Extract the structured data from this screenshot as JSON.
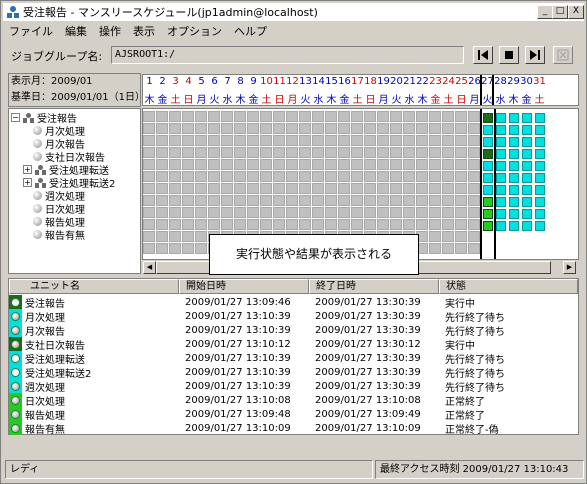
{
  "window": {
    "title": "受注報告 - マンスリースケジュール(jp1admin@localhost)",
    "min": "_",
    "max": "□",
    "close": "X"
  },
  "menu": [
    "ファイル",
    "編集",
    "操作",
    "表示",
    "オプション",
    "ヘルプ"
  ],
  "jobgroup": {
    "label": "ジョブグループ名:",
    "value": "AJSROOT1:/"
  },
  "info": {
    "month": "表示月：2009/01",
    "base": "基準日：2009/01/01（1日）"
  },
  "calendar": {
    "days": [
      "1",
      "2",
      "3",
      "4",
      "5",
      "6",
      "7",
      "8",
      "9",
      "10",
      "11",
      "12",
      "13",
      "14",
      "15",
      "16",
      "17",
      "18",
      "19",
      "20",
      "21",
      "22",
      "23",
      "24",
      "25",
      "26",
      "27",
      "28",
      "29",
      "30",
      "31"
    ],
    "weekdays": [
      "木",
      "金",
      "土",
      "日",
      "月",
      "火",
      "水",
      "木",
      "金",
      "土",
      "日",
      "月",
      "火",
      "水",
      "木",
      "金",
      "土",
      "日",
      "月",
      "火",
      "水",
      "木",
      "金",
      "土",
      "日",
      "月",
      "火",
      "水",
      "木",
      "金",
      "土"
    ],
    "weekday_colors": [
      "#0000c0",
      "#0000c0",
      "#d00000",
      "#d00000",
      "#0000c0",
      "#0000c0",
      "#0000c0",
      "#0000c0",
      "#0000c0",
      "#d00000",
      "#d00000",
      "#d00000",
      "#0000c0",
      "#0000c0",
      "#0000c0",
      "#0000c0",
      "#d00000",
      "#d00000",
      "#0000c0",
      "#0000c0",
      "#0000c0",
      "#0000c0",
      "#d00000",
      "#d00000",
      "#d00000",
      "#0000c0",
      "#0000c0",
      "#0000c0",
      "#0000c0",
      "#0000c0",
      "#d00000"
    ]
  },
  "tree": [
    {
      "label": "受注報告",
      "type": "group",
      "toggle": "⊟"
    },
    {
      "label": "月次処理",
      "type": "job"
    },
    {
      "label": "月次報告",
      "type": "job"
    },
    {
      "label": "支社日次報告",
      "type": "job"
    },
    {
      "label": "受注処理転送",
      "type": "group",
      "toggle": "⊞"
    },
    {
      "label": "受注処理転送2",
      "type": "group",
      "toggle": "⊞"
    },
    {
      "label": "週次処理",
      "type": "job"
    },
    {
      "label": "日次処理",
      "type": "job"
    },
    {
      "label": "報告処理",
      "type": "job"
    },
    {
      "label": "報告有無",
      "type": "job"
    }
  ],
  "status_cells": [
    [
      "#1d6b1d",
      "#00e0e0",
      "#00e0e0",
      "#00e0e0",
      "#00e0e0"
    ],
    [
      "#00e0e0",
      "#00e0e0",
      "#00e0e0",
      "#00e0e0",
      "#00e0e0"
    ],
    [
      "#00e0e0",
      "#00e0e0",
      "#00e0e0",
      "#00e0e0",
      "#00e0e0"
    ],
    [
      "#1d6b1d",
      "#00e0e0",
      "#00e0e0",
      "#00e0e0",
      "#00e0e0"
    ],
    [
      "#00e0e0",
      "#00e0e0",
      "#00e0e0",
      "#00e0e0",
      "#00e0e0"
    ],
    [
      "#00e0e0",
      "#00e0e0",
      "#00e0e0",
      "#00e0e0",
      "#00e0e0"
    ],
    [
      "#00e0e0",
      "#00e0e0",
      "#00e0e0",
      "#00e0e0",
      "#00e0e0"
    ],
    [
      "#22cc22",
      "#00e0e0",
      "#00e0e0",
      "#00e0e0",
      "#00e0e0"
    ],
    [
      "#22cc22",
      "#00e0e0",
      "#00e0e0",
      "#00e0e0",
      "#00e0e0"
    ],
    [
      "#22cc22",
      "#00e0e0",
      "#00e0e0",
      "#00e0e0",
      "#00e0e0"
    ]
  ],
  "tooltip": "実行状態や結果が表示される",
  "list": {
    "headers": [
      "ユニット名",
      "開始日時",
      "終了日時",
      "状態"
    ],
    "rows": [
      {
        "name": "受注報告",
        "start": "2009/01/27  13:09:46",
        "end": "2009/01/27  13:30:39",
        "status": "実行中",
        "icon": "group",
        "color": "#1d6b1d"
      },
      {
        "name": "月次処理",
        "start": "2009/01/27  13:10:39",
        "end": "2009/01/27  13:30:39",
        "status": "先行終了待ち",
        "icon": "job",
        "color": "#00e0e0"
      },
      {
        "name": "月次報告",
        "start": "2009/01/27  13:10:39",
        "end": "2009/01/27  13:30:39",
        "status": "先行終了待ち",
        "icon": "job",
        "color": "#00e0e0"
      },
      {
        "name": "支社日次報告",
        "start": "2009/01/27  13:10:12",
        "end": "2009/01/27  13:30:12",
        "status": "実行中",
        "icon": "job",
        "color": "#1d6b1d"
      },
      {
        "name": "受注処理転送",
        "start": "2009/01/27  13:10:39",
        "end": "2009/01/27  13:30:39",
        "status": "先行終了待ち",
        "icon": "group",
        "color": "#00e0e0"
      },
      {
        "name": "受注処理転送2",
        "start": "2009/01/27  13:10:39",
        "end": "2009/01/27  13:30:39",
        "status": "先行終了待ち",
        "icon": "group",
        "color": "#00e0e0"
      },
      {
        "name": "週次処理",
        "start": "2009/01/27  13:10:39",
        "end": "2009/01/27  13:30:39",
        "status": "先行終了待ち",
        "icon": "job",
        "color": "#00e0e0"
      },
      {
        "name": "日次処理",
        "start": "2009/01/27  13:10:08",
        "end": "2009/01/27  13:10:08",
        "status": "正常終了",
        "icon": "job",
        "color": "#22cc22"
      },
      {
        "name": "報告処理",
        "start": "2009/01/27  13:09:48",
        "end": "2009/01/27  13:09:49",
        "status": "正常終了",
        "icon": "job",
        "color": "#22cc22"
      },
      {
        "name": "報告有無",
        "start": "2009/01/27  13:10:09",
        "end": "2009/01/27  13:10:09",
        "status": "正常終了-偽",
        "icon": "job",
        "color": "#22cc22"
      }
    ]
  },
  "statusbar": {
    "left": "レディ",
    "right": "最終アクセス時刻  2009/01/27  13:10:43"
  }
}
